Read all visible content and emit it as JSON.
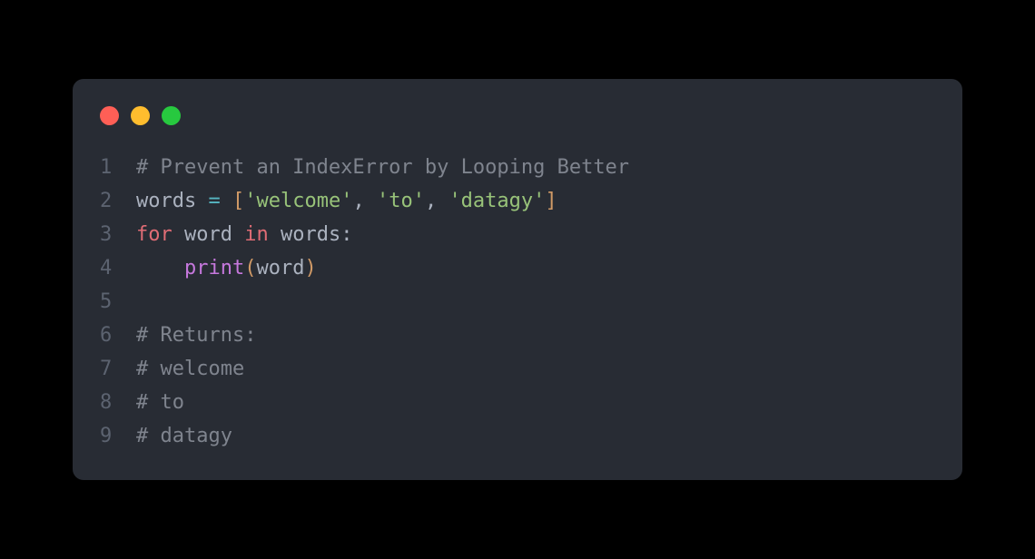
{
  "window": {
    "traffic_lights": [
      "red",
      "yellow",
      "green"
    ]
  },
  "code": {
    "lines": [
      {
        "number": "1",
        "tokens": [
          {
            "text": "# Prevent an IndexError by Looping Better",
            "class": "comment"
          }
        ]
      },
      {
        "number": "2",
        "tokens": [
          {
            "text": "words ",
            "class": "default"
          },
          {
            "text": "=",
            "class": "operator"
          },
          {
            "text": " ",
            "class": "default"
          },
          {
            "text": "[",
            "class": "bracket"
          },
          {
            "text": "'welcome'",
            "class": "string"
          },
          {
            "text": ", ",
            "class": "default"
          },
          {
            "text": "'to'",
            "class": "string"
          },
          {
            "text": ", ",
            "class": "default"
          },
          {
            "text": "'datagy'",
            "class": "string"
          },
          {
            "text": "]",
            "class": "bracket"
          }
        ]
      },
      {
        "number": "3",
        "tokens": [
          {
            "text": "for",
            "class": "keyword-red"
          },
          {
            "text": " word ",
            "class": "default"
          },
          {
            "text": "in",
            "class": "keyword-red"
          },
          {
            "text": " words:",
            "class": "default"
          }
        ]
      },
      {
        "number": "4",
        "tokens": [
          {
            "text": "    ",
            "class": "default"
          },
          {
            "text": "print",
            "class": "function"
          },
          {
            "text": "(",
            "class": "bracket"
          },
          {
            "text": "word",
            "class": "default"
          },
          {
            "text": ")",
            "class": "bracket"
          }
        ]
      },
      {
        "number": "5",
        "tokens": [
          {
            "text": " ",
            "class": "default"
          }
        ]
      },
      {
        "number": "6",
        "tokens": [
          {
            "text": "# Returns:",
            "class": "comment"
          }
        ]
      },
      {
        "number": "7",
        "tokens": [
          {
            "text": "# welcome",
            "class": "comment"
          }
        ]
      },
      {
        "number": "8",
        "tokens": [
          {
            "text": "# to",
            "class": "comment"
          }
        ]
      },
      {
        "number": "9",
        "tokens": [
          {
            "text": "# datagy",
            "class": "comment"
          }
        ]
      }
    ]
  }
}
